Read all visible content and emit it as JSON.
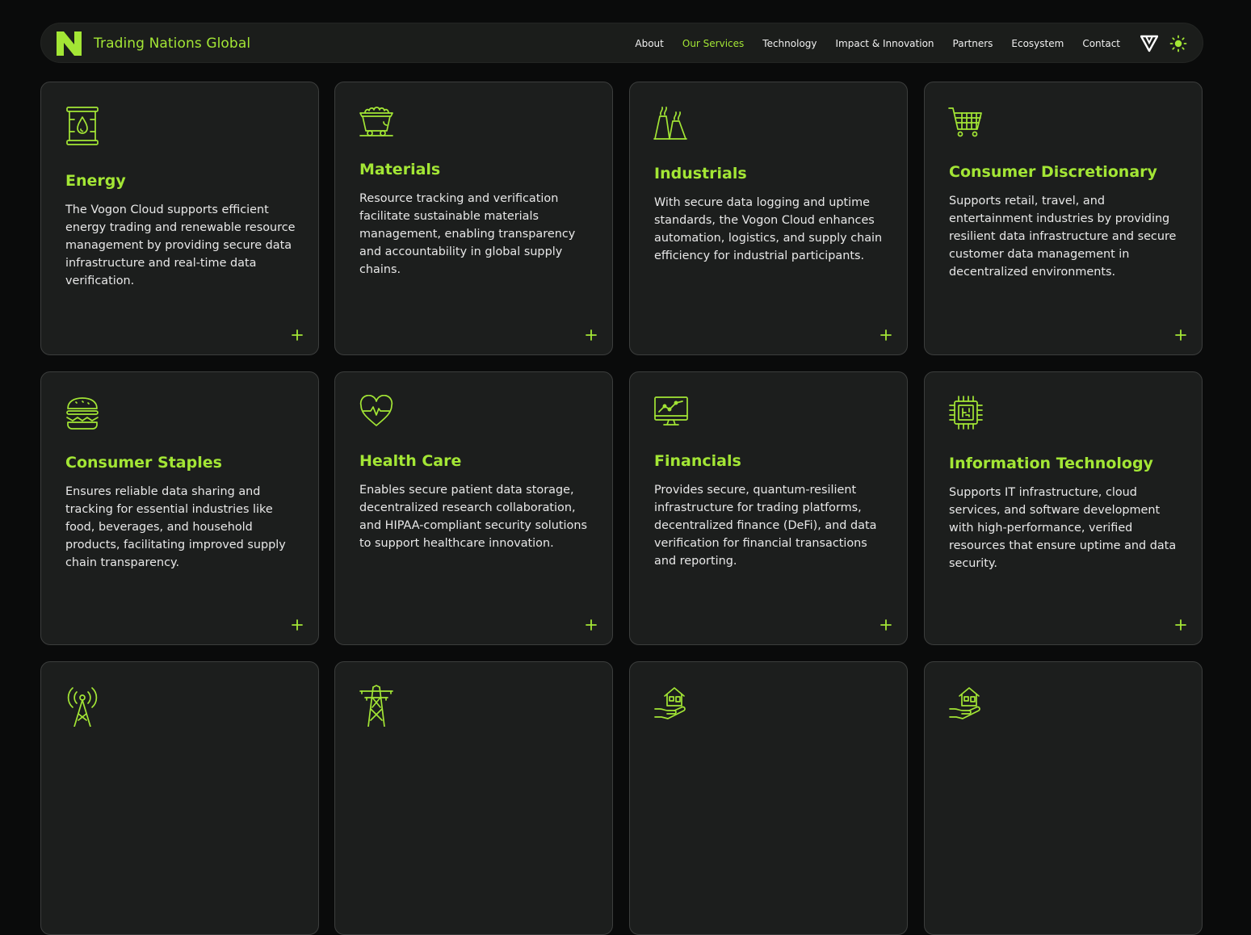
{
  "header": {
    "brand": "Trading Nations Global",
    "nav": [
      {
        "label": "About"
      },
      {
        "label": "Our Services"
      },
      {
        "label": "Technology"
      },
      {
        "label": "Impact & Innovation"
      },
      {
        "label": "Partners"
      },
      {
        "label": "Ecosystem"
      },
      {
        "label": "Contact"
      }
    ],
    "active_nav": "Our Services",
    "icons": [
      "logo-icon",
      "vogon-icon",
      "sun-icon"
    ]
  },
  "colors": {
    "accent": "#a3e635",
    "background": "#0a0b0b",
    "card": "#1c1e1d",
    "card_border": "#3c3e3d",
    "text": "#e8e8e8"
  },
  "sectors": [
    {
      "title": "Energy",
      "icon": "oil-barrel-icon",
      "description": "The Vogon Cloud supports efficient energy trading and renewable resource management by providing secure data infrastructure and real-time data verification."
    },
    {
      "title": "Materials",
      "icon": "mine-cart-icon",
      "description": "Resource tracking and verification facilitate sustainable materials management, enabling transparency and accountability in global supply chains."
    },
    {
      "title": "Industrials",
      "icon": "factory-icon",
      "description": "With secure data logging and uptime standards, the Vogon Cloud enhances automation, logistics, and supply chain efficiency for industrial participants."
    },
    {
      "title": "Consumer Discretionary",
      "icon": "shopping-cart-icon",
      "description": "Supports retail, travel, and entertainment industries by providing resilient data infrastructure and secure customer data management in decentralized environments."
    },
    {
      "title": "Consumer Staples",
      "icon": "burger-icon",
      "description": "Ensures reliable data sharing and tracking for essential industries like food, beverages, and household products, facilitating improved supply chain transparency."
    },
    {
      "title": "Health Care",
      "icon": "heart-pulse-icon",
      "description": "Enables secure patient data storage, decentralized research collaboration, and HIPAA-compliant security solutions to support healthcare innovation."
    },
    {
      "title": "Financials",
      "icon": "monitor-chart-icon",
      "description": "Provides secure, quantum-resilient infrastructure for trading platforms, decentralized finance (DeFi), and data verification for financial transactions and reporting."
    },
    {
      "title": "Information Technology",
      "icon": "chip-icon",
      "description": "Supports IT infrastructure, cloud services, and software development with high-performance, verified resources that ensure uptime and data security."
    },
    {
      "title": "",
      "icon": "antenna-tower-icon",
      "description": ""
    },
    {
      "title": "",
      "icon": "power-pylon-icon",
      "description": ""
    },
    {
      "title": "",
      "icon": "hand-house-icon",
      "description": ""
    },
    {
      "title": "",
      "icon": "hand-house-icon",
      "description": ""
    }
  ]
}
